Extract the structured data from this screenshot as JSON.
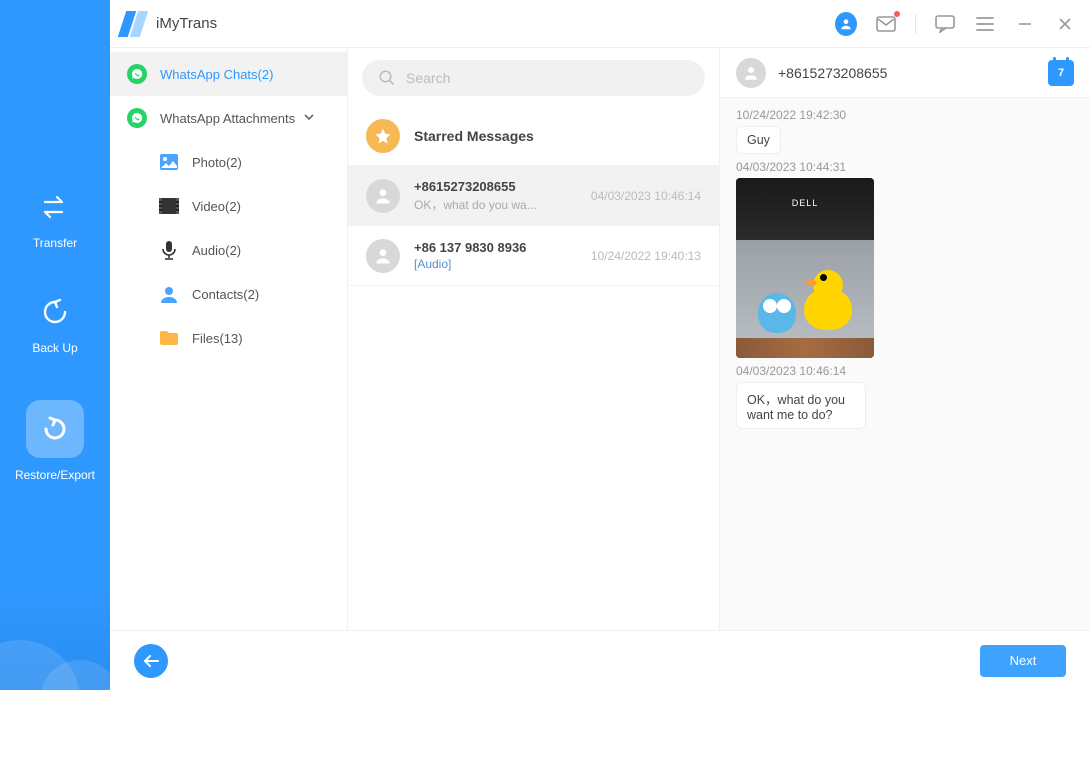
{
  "app": {
    "title": "iMyTrans"
  },
  "titlebar": {
    "calendar_day": "7"
  },
  "nav": {
    "items": [
      {
        "key": "transfer",
        "label": "Transfer"
      },
      {
        "key": "backup",
        "label": "Back Up"
      },
      {
        "key": "restore",
        "label": "Restore/Export"
      }
    ]
  },
  "sidebar": {
    "chats": {
      "label": "WhatsApp Chats(2)"
    },
    "attachments": {
      "label": "WhatsApp Attachments"
    },
    "sub": {
      "photo": "Photo(2)",
      "video": "Video(2)",
      "audio": "Audio(2)",
      "contacts": "Contacts(2)",
      "files": "Files(13)"
    }
  },
  "search": {
    "placeholder": "Search"
  },
  "chatlist": {
    "starred": "Starred Messages",
    "items": [
      {
        "title": "+8615273208655",
        "preview": "OK，what do you wa...",
        "ts": "04/03/2023 10:46:14"
      },
      {
        "title": "+86 137 9830 8936",
        "preview": "[Audio]",
        "ts": "10/24/2022 19:40:13",
        "preview_link": true
      }
    ]
  },
  "conversation": {
    "name": "+8615273208655",
    "messages": [
      {
        "ts": "10/24/2022 19:42:30",
        "type": "text",
        "text": "Guy"
      },
      {
        "ts": "04/03/2023 10:44:31",
        "type": "image"
      },
      {
        "ts": "04/03/2023 10:46:14",
        "type": "text",
        "text": "OK，what do you want me to do?"
      }
    ]
  },
  "footer": {
    "next": "Next"
  }
}
